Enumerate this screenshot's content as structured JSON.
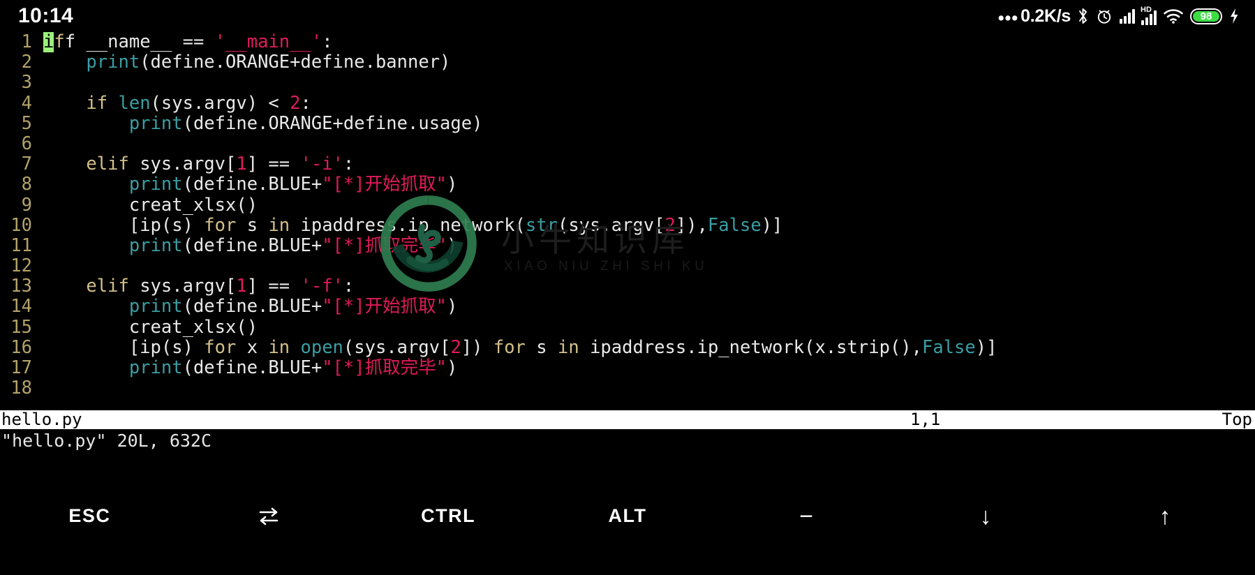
{
  "statusbar": {
    "clock": "10:14",
    "network_speed": "0.2K/s",
    "dots": "•••",
    "icons": [
      "bluetooth-icon",
      "alarm-icon",
      "signal-icon",
      "hd-signal-icon",
      "wifi-icon",
      "battery-icon",
      "charging-icon"
    ],
    "battery_percent": "98",
    "battery_color": "#3ddc45",
    "hd_label": "HD"
  },
  "editor": {
    "app": "vim",
    "lines": [
      {
        "n": "1",
        "tokens": [
          {
            "t": "if",
            "c": "cursor"
          },
          {
            "t": "f ",
            "c": "plain"
          },
          {
            "t": "__name__ == ",
            "c": "plain"
          },
          {
            "t": "'__main__'",
            "c": "str"
          },
          {
            "t": ":",
            "c": "plain"
          }
        ]
      },
      {
        "n": "2",
        "tokens": [
          {
            "t": "    ",
            "c": "plain"
          },
          {
            "t": "print",
            "c": "fn"
          },
          {
            "t": "(define.ORANGE+define.banner)",
            "c": "plain"
          }
        ]
      },
      {
        "n": "3",
        "tokens": []
      },
      {
        "n": "4",
        "tokens": [
          {
            "t": "    ",
            "c": "plain"
          },
          {
            "t": "if ",
            "c": "kw"
          },
          {
            "t": "len",
            "c": "fn"
          },
          {
            "t": "(sys.argv) < ",
            "c": "plain"
          },
          {
            "t": "2",
            "c": "num"
          },
          {
            "t": ":",
            "c": "plain"
          }
        ]
      },
      {
        "n": "5",
        "tokens": [
          {
            "t": "        ",
            "c": "plain"
          },
          {
            "t": "print",
            "c": "fn"
          },
          {
            "t": "(define.ORANGE+define.usage)",
            "c": "plain"
          }
        ]
      },
      {
        "n": "6",
        "tokens": []
      },
      {
        "n": "7",
        "tokens": [
          {
            "t": "    ",
            "c": "plain"
          },
          {
            "t": "elif ",
            "c": "kw"
          },
          {
            "t": "sys.argv[",
            "c": "plain"
          },
          {
            "t": "1",
            "c": "num"
          },
          {
            "t": "] == ",
            "c": "plain"
          },
          {
            "t": "'-i'",
            "c": "str"
          },
          {
            "t": ":",
            "c": "plain"
          }
        ]
      },
      {
        "n": "8",
        "tokens": [
          {
            "t": "        ",
            "c": "plain"
          },
          {
            "t": "print",
            "c": "fn"
          },
          {
            "t": "(define.BLUE+",
            "c": "plain"
          },
          {
            "t": "\"[*]开始抓取\"",
            "c": "str"
          },
          {
            "t": ")",
            "c": "plain"
          }
        ]
      },
      {
        "n": "9",
        "tokens": [
          {
            "t": "        creat_xlsx()",
            "c": "plain"
          }
        ]
      },
      {
        "n": "10",
        "tokens": [
          {
            "t": "        [ip(s) ",
            "c": "plain"
          },
          {
            "t": "for ",
            "c": "kw"
          },
          {
            "t": "s ",
            "c": "plain"
          },
          {
            "t": "in ",
            "c": "kw"
          },
          {
            "t": "ipaddress.ip_network(",
            "c": "plain"
          },
          {
            "t": "str",
            "c": "fn"
          },
          {
            "t": "(sys.argv[",
            "c": "plain"
          },
          {
            "t": "2",
            "c": "num"
          },
          {
            "t": "]),",
            "c": "plain"
          },
          {
            "t": "False",
            "c": "fn"
          },
          {
            "t": ")]",
            "c": "plain"
          }
        ]
      },
      {
        "n": "11",
        "tokens": [
          {
            "t": "        ",
            "c": "plain"
          },
          {
            "t": "print",
            "c": "fn"
          },
          {
            "t": "(define.BLUE+",
            "c": "plain"
          },
          {
            "t": "\"[*]抓取完毕\"",
            "c": "str"
          },
          {
            "t": ")",
            "c": "plain"
          }
        ]
      },
      {
        "n": "12",
        "tokens": []
      },
      {
        "n": "13",
        "tokens": [
          {
            "t": "    ",
            "c": "plain"
          },
          {
            "t": "elif ",
            "c": "kw"
          },
          {
            "t": "sys.argv[",
            "c": "plain"
          },
          {
            "t": "1",
            "c": "num"
          },
          {
            "t": "] == ",
            "c": "plain"
          },
          {
            "t": "'-f'",
            "c": "str"
          },
          {
            "t": ":",
            "c": "plain"
          }
        ]
      },
      {
        "n": "14",
        "tokens": [
          {
            "t": "        ",
            "c": "plain"
          },
          {
            "t": "print",
            "c": "fn"
          },
          {
            "t": "(define.BLUE+",
            "c": "plain"
          },
          {
            "t": "\"[*]开始抓取\"",
            "c": "str"
          },
          {
            "t": ")",
            "c": "plain"
          }
        ]
      },
      {
        "n": "15",
        "tokens": [
          {
            "t": "        creat_xlsx()",
            "c": "plain"
          }
        ]
      },
      {
        "n": "16",
        "tokens": [
          {
            "t": "        [ip(s) ",
            "c": "plain"
          },
          {
            "t": "for ",
            "c": "kw"
          },
          {
            "t": "x ",
            "c": "plain"
          },
          {
            "t": "in ",
            "c": "kw"
          },
          {
            "t": "open",
            "c": "fn"
          },
          {
            "t": "(sys.argv[",
            "c": "plain"
          },
          {
            "t": "2",
            "c": "num"
          },
          {
            "t": "]) ",
            "c": "plain"
          },
          {
            "t": "for ",
            "c": "kw"
          },
          {
            "t": "s ",
            "c": "plain"
          },
          {
            "t": "in ",
            "c": "kw"
          },
          {
            "t": "ipaddress.ip_network(x.strip(),",
            "c": "plain"
          },
          {
            "t": "False",
            "c": "fn"
          },
          {
            "t": ")]",
            "c": "plain"
          }
        ]
      },
      {
        "n": "17",
        "tokens": [
          {
            "t": "        ",
            "c": "plain"
          },
          {
            "t": "print",
            "c": "fn"
          },
          {
            "t": "(define.BLUE+",
            "c": "plain"
          },
          {
            "t": "\"[*]抓取完毕\"",
            "c": "str"
          },
          {
            "t": ")",
            "c": "plain"
          }
        ]
      },
      {
        "n": "18",
        "tokens": []
      }
    ]
  },
  "watermark": {
    "text": "小牛知识库",
    "subtext": "XIAO NIU ZHI SHI KU",
    "logo_color": "#2f7d4f"
  },
  "vim_status": {
    "filename": "hello.py",
    "position": "1,1",
    "location": "Top"
  },
  "vim_message": "\"hello.py\" 20L, 632C",
  "keybar": {
    "keys": [
      {
        "label": "ESC",
        "icon": "esc-key"
      },
      {
        "label": "",
        "icon": "tab-key"
      },
      {
        "label": "CTRL",
        "icon": "ctrl-key"
      },
      {
        "label": "ALT",
        "icon": "alt-key"
      },
      {
        "label": "−",
        "icon": "minus-key"
      },
      {
        "label": "↓",
        "icon": "arrow-down-key"
      },
      {
        "label": "↑",
        "icon": "arrow-up-key"
      }
    ]
  },
  "colors": {
    "background": "#000000",
    "foreground": "#e6e6e6",
    "linenumber": "#b3a369",
    "keyword": "#d3c08a",
    "builtin": "#3b9ea3",
    "string": "#e01b5a",
    "number": "#e01b5a",
    "cursor_bg": "#9cf07a",
    "statusline_bg": "#ffffff",
    "statusline_fg": "#000000"
  }
}
